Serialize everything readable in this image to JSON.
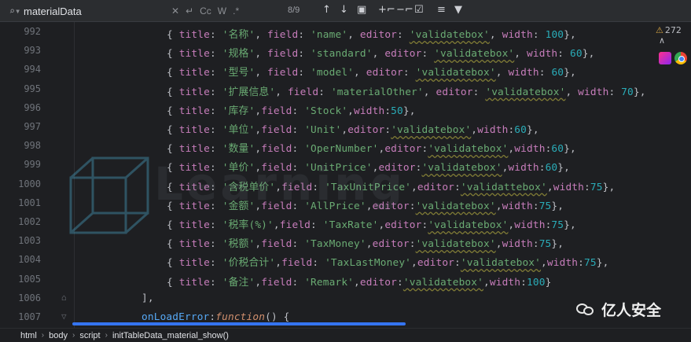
{
  "find": {
    "query": "materialData",
    "options": [
      "Cc",
      "W",
      ".*"
    ],
    "match_count": "8/9",
    "toolbar": [
      "up-arrow",
      "down-arrow",
      "select-all",
      "add-occurrence",
      "remove-occurrence",
      "select-occurrences",
      "show-in-file",
      "filter"
    ]
  },
  "gutter": {
    "lines": [
      "992",
      "993",
      "994",
      "995",
      "996",
      "997",
      "998",
      "999",
      "1000",
      "1001",
      "1002",
      "1003",
      "1004",
      "1005",
      "1006",
      "1007"
    ]
  },
  "code": {
    "lines": [
      [
        [
          "p",
          "{ "
        ],
        [
          "k",
          "title"
        ],
        [
          "p",
          ": "
        ],
        [
          "s",
          "'名称'"
        ],
        [
          "p",
          ", "
        ],
        [
          "k",
          "field"
        ],
        [
          "p",
          ": "
        ],
        [
          "s",
          "'name'"
        ],
        [
          "p",
          ", "
        ],
        [
          "k",
          "editor"
        ],
        [
          "p",
          ": "
        ],
        [
          "su",
          "'validatebox'"
        ],
        [
          "p",
          ", "
        ],
        [
          "k",
          "width"
        ],
        [
          "p",
          ": "
        ],
        [
          "n",
          "100"
        ],
        [
          "p",
          "},"
        ]
      ],
      [
        [
          "p",
          "{ "
        ],
        [
          "k",
          "title"
        ],
        [
          "p",
          ": "
        ],
        [
          "s",
          "'规格'"
        ],
        [
          "p",
          ", "
        ],
        [
          "k",
          "field"
        ],
        [
          "p",
          ": "
        ],
        [
          "s",
          "'standard'"
        ],
        [
          "p",
          ", "
        ],
        [
          "k",
          "editor"
        ],
        [
          "p",
          ": "
        ],
        [
          "su",
          "'validatebox'"
        ],
        [
          "p",
          ", "
        ],
        [
          "k",
          "width"
        ],
        [
          "p",
          ": "
        ],
        [
          "n",
          "60"
        ],
        [
          "p",
          "},"
        ]
      ],
      [
        [
          "p",
          "{ "
        ],
        [
          "k",
          "title"
        ],
        [
          "p",
          ": "
        ],
        [
          "s",
          "'型号'"
        ],
        [
          "p",
          ", "
        ],
        [
          "k",
          "field"
        ],
        [
          "p",
          ": "
        ],
        [
          "s",
          "'model'"
        ],
        [
          "p",
          ", "
        ],
        [
          "k",
          "editor"
        ],
        [
          "p",
          ": "
        ],
        [
          "su",
          "'validatebox'"
        ],
        [
          "p",
          ", "
        ],
        [
          "k",
          "width"
        ],
        [
          "p",
          ": "
        ],
        [
          "n",
          "60"
        ],
        [
          "p",
          "},"
        ]
      ],
      [
        [
          "p",
          "{ "
        ],
        [
          "k",
          "title"
        ],
        [
          "p",
          ": "
        ],
        [
          "s",
          "'扩展信息'"
        ],
        [
          "p",
          ", "
        ],
        [
          "k",
          "field"
        ],
        [
          "p",
          ": "
        ],
        [
          "s",
          "'materialOther'"
        ],
        [
          "p",
          ", "
        ],
        [
          "k",
          "editor"
        ],
        [
          "p",
          ": "
        ],
        [
          "su",
          "'validatebox'"
        ],
        [
          "p",
          ", "
        ],
        [
          "k",
          "width"
        ],
        [
          "p",
          ": "
        ],
        [
          "n",
          "70"
        ],
        [
          "p",
          "},"
        ]
      ],
      [
        [
          "p",
          "{ "
        ],
        [
          "k",
          "title"
        ],
        [
          "p",
          ": "
        ],
        [
          "s",
          "'库存'"
        ],
        [
          "p",
          ","
        ],
        [
          "k",
          "field"
        ],
        [
          "p",
          ": "
        ],
        [
          "s",
          "'Stock'"
        ],
        [
          "p",
          ","
        ],
        [
          "k",
          "width"
        ],
        [
          "p",
          ":"
        ],
        [
          "n",
          "50"
        ],
        [
          "p",
          "},"
        ]
      ],
      [
        [
          "p",
          "{ "
        ],
        [
          "k",
          "title"
        ],
        [
          "p",
          ": "
        ],
        [
          "s",
          "'单位'"
        ],
        [
          "p",
          ","
        ],
        [
          "k",
          "field"
        ],
        [
          "p",
          ": "
        ],
        [
          "s",
          "'Unit'"
        ],
        [
          "p",
          ","
        ],
        [
          "k",
          "editor"
        ],
        [
          "p",
          ":"
        ],
        [
          "su",
          "'validatebox'"
        ],
        [
          "p",
          ","
        ],
        [
          "k",
          "width"
        ],
        [
          "p",
          ":"
        ],
        [
          "n",
          "60"
        ],
        [
          "p",
          "},"
        ]
      ],
      [
        [
          "p",
          "{ "
        ],
        [
          "k",
          "title"
        ],
        [
          "p",
          ": "
        ],
        [
          "s",
          "'数量'"
        ],
        [
          "p",
          ","
        ],
        [
          "k",
          "field"
        ],
        [
          "p",
          ": "
        ],
        [
          "s",
          "'OperNumber'"
        ],
        [
          "p",
          ","
        ],
        [
          "k",
          "editor"
        ],
        [
          "p",
          ":"
        ],
        [
          "su",
          "'validatebox'"
        ],
        [
          "p",
          ","
        ],
        [
          "k",
          "width"
        ],
        [
          "p",
          ":"
        ],
        [
          "n",
          "60"
        ],
        [
          "p",
          "},"
        ]
      ],
      [
        [
          "p",
          "{ "
        ],
        [
          "k",
          "title"
        ],
        [
          "p",
          ": "
        ],
        [
          "s",
          "'单价'"
        ],
        [
          "p",
          ","
        ],
        [
          "k",
          "field"
        ],
        [
          "p",
          ": "
        ],
        [
          "s",
          "'UnitPrice'"
        ],
        [
          "p",
          ","
        ],
        [
          "k",
          "editor"
        ],
        [
          "p",
          ":"
        ],
        [
          "su",
          "'validatebox'"
        ],
        [
          "p",
          ","
        ],
        [
          "k",
          "width"
        ],
        [
          "p",
          ":"
        ],
        [
          "n",
          "60"
        ],
        [
          "p",
          "},"
        ]
      ],
      [
        [
          "p",
          "{ "
        ],
        [
          "k",
          "title"
        ],
        [
          "p",
          ": "
        ],
        [
          "s",
          "'含税单价'"
        ],
        [
          "p",
          ","
        ],
        [
          "k",
          "field"
        ],
        [
          "p",
          ": "
        ],
        [
          "s",
          "'TaxUnitPrice'"
        ],
        [
          "p",
          ","
        ],
        [
          "k",
          "editor"
        ],
        [
          "p",
          ":"
        ],
        [
          "su",
          "'validattebox'"
        ],
        [
          "p",
          ","
        ],
        [
          "k",
          "width"
        ],
        [
          "p",
          ":"
        ],
        [
          "n",
          "75"
        ],
        [
          "p",
          "},"
        ]
      ],
      [
        [
          "p",
          "{ "
        ],
        [
          "k",
          "title"
        ],
        [
          "p",
          ": "
        ],
        [
          "s",
          "'金额'"
        ],
        [
          "p",
          ","
        ],
        [
          "k",
          "field"
        ],
        [
          "p",
          ": "
        ],
        [
          "s",
          "'AllPrice'"
        ],
        [
          "p",
          ","
        ],
        [
          "k",
          "editor"
        ],
        [
          "p",
          ":"
        ],
        [
          "su",
          "'validatebox'"
        ],
        [
          "p",
          ","
        ],
        [
          "k",
          "width"
        ],
        [
          "p",
          ":"
        ],
        [
          "n",
          "75"
        ],
        [
          "p",
          "},"
        ]
      ],
      [
        [
          "p",
          "{ "
        ],
        [
          "k",
          "title"
        ],
        [
          "p",
          ": "
        ],
        [
          "s",
          "'税率(%)'"
        ],
        [
          "p",
          ","
        ],
        [
          "k",
          "field"
        ],
        [
          "p",
          ": "
        ],
        [
          "s",
          "'TaxRate'"
        ],
        [
          "p",
          ","
        ],
        [
          "k",
          "editor"
        ],
        [
          "p",
          ":"
        ],
        [
          "su",
          "'validatebox'"
        ],
        [
          "p",
          ","
        ],
        [
          "k",
          "width"
        ],
        [
          "p",
          ":"
        ],
        [
          "n",
          "75"
        ],
        [
          "p",
          "},"
        ]
      ],
      [
        [
          "p",
          "{ "
        ],
        [
          "k",
          "title"
        ],
        [
          "p",
          ": "
        ],
        [
          "s",
          "'税额'"
        ],
        [
          "p",
          ","
        ],
        [
          "k",
          "field"
        ],
        [
          "p",
          ": "
        ],
        [
          "s",
          "'TaxMoney'"
        ],
        [
          "p",
          ","
        ],
        [
          "k",
          "editor"
        ],
        [
          "p",
          ":"
        ],
        [
          "su",
          "'validatebox'"
        ],
        [
          "p",
          ","
        ],
        [
          "k",
          "width"
        ],
        [
          "p",
          ":"
        ],
        [
          "n",
          "75"
        ],
        [
          "p",
          "},"
        ]
      ],
      [
        [
          "p",
          "{ "
        ],
        [
          "k",
          "title"
        ],
        [
          "p",
          ": "
        ],
        [
          "s",
          "'价税合计'"
        ],
        [
          "p",
          ","
        ],
        [
          "k",
          "field"
        ],
        [
          "p",
          ": "
        ],
        [
          "s",
          "'TaxLastMoney'"
        ],
        [
          "p",
          ","
        ],
        [
          "k",
          "editor"
        ],
        [
          "p",
          ":"
        ],
        [
          "su",
          "'validatebox'"
        ],
        [
          "p",
          ","
        ],
        [
          "k",
          "width"
        ],
        [
          "p",
          ":"
        ],
        [
          "n",
          "75"
        ],
        [
          "p",
          "},"
        ]
      ],
      [
        [
          "p",
          "{ "
        ],
        [
          "k",
          "title"
        ],
        [
          "p",
          ": "
        ],
        [
          "s",
          "'备注'"
        ],
        [
          "p",
          ","
        ],
        [
          "k",
          "field"
        ],
        [
          "p",
          ": "
        ],
        [
          "s",
          "'Remark'"
        ],
        [
          "p",
          ","
        ],
        [
          "k",
          "editor"
        ],
        [
          "p",
          ":"
        ],
        [
          "su",
          "'validatebox'"
        ],
        [
          "p",
          ","
        ],
        [
          "k",
          "width"
        ],
        [
          "p",
          ":"
        ],
        [
          "n",
          "100"
        ],
        [
          "p",
          "}"
        ]
      ],
      [
        [
          "p",
          "],"
        ]
      ],
      [
        [
          "f",
          "onLoadError"
        ],
        [
          "p",
          ":"
        ],
        [
          "kw",
          "function"
        ],
        [
          "p",
          "() {"
        ]
      ]
    ],
    "indent": [
      1,
      1,
      1,
      1,
      1,
      1,
      1,
      1,
      1,
      1,
      1,
      1,
      1,
      1,
      0,
      0
    ]
  },
  "inspection": {
    "warnings": "272"
  },
  "watermark": "Learning",
  "breadcrumb": [
    "html",
    "body",
    "script",
    "initTableData_material_show()"
  ],
  "brand": {
    "name": "亿人安全"
  }
}
